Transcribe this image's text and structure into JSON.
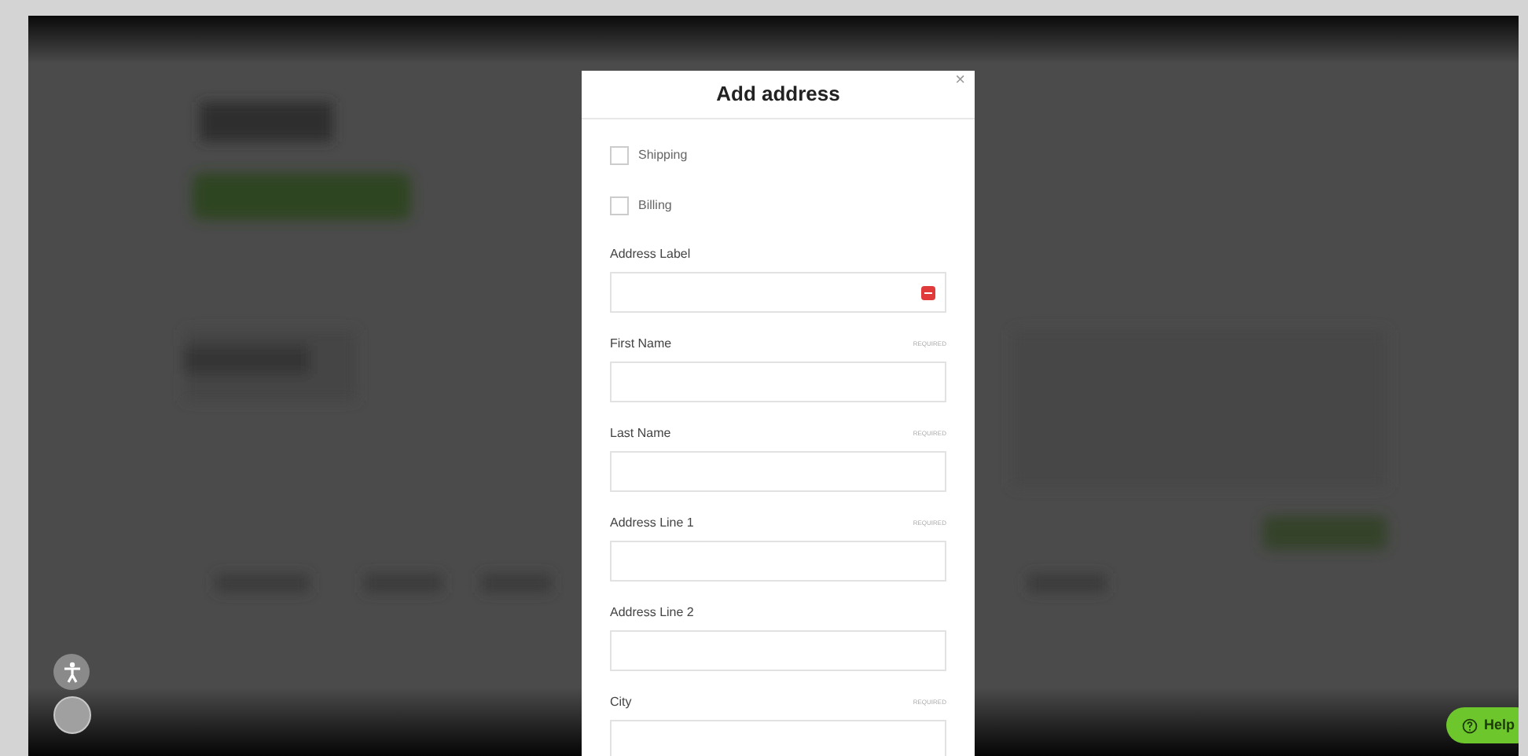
{
  "modal": {
    "title": "Add address",
    "close": "×",
    "checkboxes": [
      {
        "label": "Shipping",
        "checked": false
      },
      {
        "label": "Billing",
        "checked": false
      }
    ],
    "fields": [
      {
        "label": "Address Label",
        "kind": "autofill"
      },
      {
        "label": "First Name",
        "required": "REQUIRED",
        "kind": "text"
      },
      {
        "label": "Last Name",
        "required": "REQUIRED",
        "kind": "text"
      },
      {
        "label": "Address Line 1",
        "required": "REQUIRED",
        "kind": "text"
      },
      {
        "label": "Address Line 2",
        "kind": "text"
      },
      {
        "label": "City",
        "required": "REQUIRED",
        "kind": "text"
      }
    ]
  },
  "help_button": {
    "label": "Help"
  }
}
